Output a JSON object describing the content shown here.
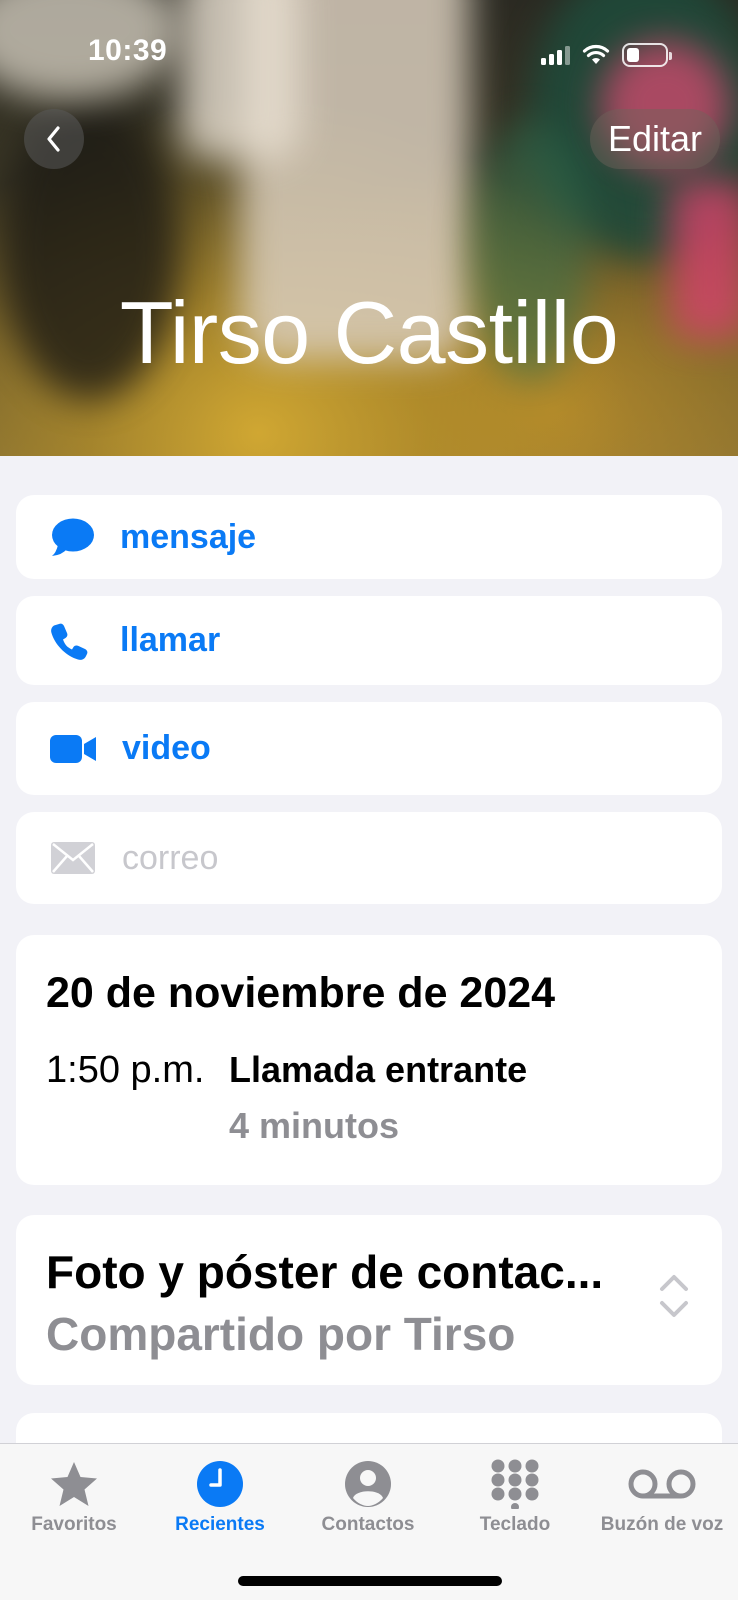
{
  "status_bar": {
    "time": "10:39"
  },
  "header": {
    "edit_label": "Editar",
    "contact_name": "Tirso Castillo"
  },
  "actions": [
    {
      "label": "mensaje",
      "icon": "message-bubble-icon",
      "enabled": true
    },
    {
      "label": "llamar",
      "icon": "phone-icon",
      "enabled": true
    },
    {
      "label": "video",
      "icon": "video-camera-icon",
      "enabled": true
    },
    {
      "label": "correo",
      "icon": "mail-icon",
      "enabled": false
    }
  ],
  "call_log": {
    "date": "20 de noviembre de 2024",
    "time": "1:50 p.m.",
    "type": "Llamada entrante",
    "duration": "4 minutos"
  },
  "contact_poster": {
    "title": "Foto y póster de contac...",
    "subtitle": "Compartido por Tirso"
  },
  "tabbar": {
    "tabs": [
      {
        "label": "Favoritos",
        "icon": "star-icon",
        "active": false
      },
      {
        "label": "Recientes",
        "icon": "clock-icon",
        "active": true
      },
      {
        "label": "Contactos",
        "icon": "person-circle-icon",
        "active": false
      },
      {
        "label": "Teclado",
        "icon": "keypad-icon",
        "active": false
      },
      {
        "label": "Buzón de voz",
        "icon": "voicemail-icon",
        "active": false
      }
    ]
  },
  "colors": {
    "accent": "#0a7af5",
    "secondary_text": "#8e8e93",
    "disabled": "#c7c7cc",
    "background": "#f2f2f7"
  }
}
